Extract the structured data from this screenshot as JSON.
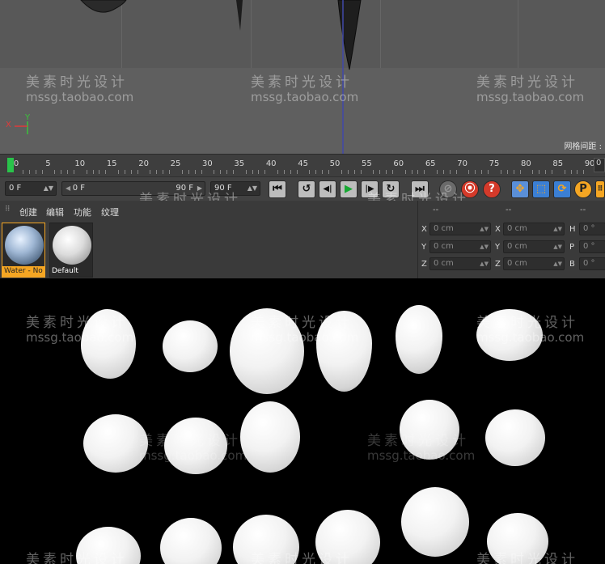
{
  "viewport": {
    "grid_label": "网格间距 :",
    "axis_y": "Y",
    "axis_x": "X"
  },
  "watermark": {
    "chinese": "美素时光设计",
    "site": "mssg.taobao.com"
  },
  "timeline": {
    "ticks": [
      "0",
      "5",
      "10",
      "15",
      "20",
      "25",
      "30",
      "35",
      "40",
      "45",
      "50",
      "55",
      "60",
      "65",
      "70",
      "75",
      "80",
      "85",
      "90"
    ],
    "end_value": "0",
    "playhead_frame": 0
  },
  "transport": {
    "current_frame": "0 F",
    "range_start": "0 F",
    "range_end": "90 F",
    "max_frame": "90 F",
    "buttons": {
      "goto_start": "⏮",
      "loop_back": "↺",
      "prev_key": "◀|",
      "play": "▶",
      "next_key": "|▶",
      "loop_fwd": "↻",
      "goto_end": "⏭",
      "record_key": "⦿",
      "autokey": "?",
      "move": "✥",
      "scale": "⬚",
      "rotate": "⟳",
      "param": "P"
    }
  },
  "material_manager": {
    "menu": [
      "创建",
      "编辑",
      "功能",
      "纹理"
    ],
    "materials": [
      {
        "name": "Water - No",
        "selected": true
      },
      {
        "name": "Default",
        "selected": false
      }
    ]
  },
  "coordinates": {
    "header_dashes": [
      "--",
      "--",
      "--"
    ],
    "rows": [
      {
        "axis1": "X",
        "val1": "0 cm",
        "axis2": "X",
        "val2": "0 cm",
        "axis3": "H",
        "val3": "0 °"
      },
      {
        "axis1": "Y",
        "val1": "0 cm",
        "axis2": "Y",
        "val2": "0 cm",
        "axis3": "P",
        "val3": "0 °"
      },
      {
        "axis1": "Z",
        "val1": "0 cm",
        "axis2": "Z",
        "val2": "0 cm",
        "axis3": "B",
        "val3": "0 °"
      }
    ]
  },
  "colors": {
    "accent_selected": "#f5a623",
    "playhead": "#29c34a",
    "axis_x": "#e03a3a",
    "axis_y": "#3ac43a"
  }
}
